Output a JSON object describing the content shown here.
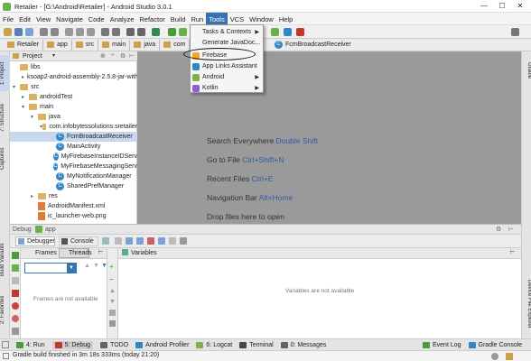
{
  "window": {
    "title": "Retailer - [G:\\Android\\Retailer] - Android Studio 3.0.1",
    "minimize": "—",
    "maximize": "☐",
    "close": "✕"
  },
  "menubar": [
    "File",
    "Edit",
    "View",
    "Navigate",
    "Code",
    "Analyze",
    "Refactor",
    "Build",
    "Run",
    "Tools",
    "VCS",
    "Window",
    "Help"
  ],
  "navbar": {
    "crumbs": [
      "Retailer",
      "app",
      "src",
      "main",
      "java",
      "com",
      "info"
    ],
    "right_crumb": "FcmBroadcastReceiver"
  },
  "project": {
    "view_label": "Project",
    "tree": [
      {
        "label": "libs",
        "kind": "folder",
        "arrow": "",
        "depth": 0
      },
      {
        "label": "ksoap2-android-assembly-2.5.8-jar-with",
        "kind": "folder",
        "arrow": "▸",
        "depth": 1
      },
      {
        "label": "src",
        "kind": "folder",
        "arrow": "▾",
        "depth": 0
      },
      {
        "label": "androidTest",
        "kind": "folder",
        "arrow": "▸",
        "depth": 1
      },
      {
        "label": "main",
        "kind": "folder",
        "arrow": "▾",
        "depth": 1
      },
      {
        "label": "java",
        "kind": "folder",
        "arrow": "▾",
        "depth": 2
      },
      {
        "label": "com.infobytessolutions.sretailer",
        "kind": "folder",
        "arrow": "▾",
        "depth": 3
      },
      {
        "label": "FcmBroadcastReceiver",
        "kind": "class",
        "arrow": "",
        "depth": 4,
        "selected": true
      },
      {
        "label": "MainActivity",
        "kind": "class",
        "arrow": "",
        "depth": 4
      },
      {
        "label": "MyFirebaseInstanceIDServ",
        "kind": "class",
        "arrow": "",
        "depth": 4
      },
      {
        "label": "MyFirebaseMessagingServ",
        "kind": "class",
        "arrow": "",
        "depth": 4
      },
      {
        "label": "MyNotificationManager",
        "kind": "class",
        "arrow": "",
        "depth": 4
      },
      {
        "label": "SharedPrefManager",
        "kind": "class",
        "arrow": "",
        "depth": 4
      },
      {
        "label": "res",
        "kind": "folder",
        "arrow": "▸",
        "depth": 2
      },
      {
        "label": "AndroidManifest.xml",
        "kind": "xml",
        "arrow": "",
        "depth": 2
      },
      {
        "label": "ic_launcher-web.png",
        "kind": "xml",
        "arrow": "",
        "depth": 2
      }
    ]
  },
  "editor_hints": [
    {
      "text": "Search Everywhere",
      "key": "Double Shift"
    },
    {
      "text": "Go to File",
      "key": "Ctrl+Shift+N"
    },
    {
      "text": "Recent Files",
      "key": "Ctrl+E"
    },
    {
      "text": "Navigation Bar",
      "key": "Alt+Home"
    },
    {
      "text": "Drop files here to open",
      "key": ""
    }
  ],
  "tools_menu": [
    {
      "label": "Tasks & Contexts",
      "submenu": true,
      "icon": ""
    },
    {
      "label": "Generate JavaDoc...",
      "submenu": false,
      "icon": ""
    },
    {
      "label": "Firebase",
      "submenu": false,
      "icon": "firebase-icon",
      "color": "#f5a623"
    },
    {
      "label": "App Links Assistant",
      "submenu": false,
      "icon": "app-links-icon",
      "color": "#2f86c8"
    },
    {
      "label": "Android",
      "submenu": true,
      "icon": "android-icon",
      "color": "#7cb342"
    },
    {
      "label": "Kotlin",
      "submenu": true,
      "icon": "kotlin-icon",
      "color": "#8e5fd4"
    }
  ],
  "debug": {
    "title": "Debug",
    "config": "app",
    "tabs": [
      "Debugger",
      "Console"
    ],
    "frames_label": "Frames",
    "threads_label": "Threads",
    "variables_label": "Variables",
    "frames_empty": "Frames are not available",
    "variables_empty": "Variables are not available"
  },
  "side_tabs": {
    "left": [
      "1: Project",
      "7: Structure",
      "Captures",
      "Build Variants",
      "2: Favorites"
    ],
    "right": [
      "Gradle",
      "Device File Explorer"
    ]
  },
  "bottom_tools": [
    {
      "label": "4: Run",
      "color": "#4a9e3a"
    },
    {
      "label": "5: Debug",
      "color": "#c0392b",
      "active": true
    },
    {
      "label": "TODO",
      "color": "#666"
    },
    {
      "label": "Android Profiler",
      "color": "#2f86c8"
    },
    {
      "label": "6: Logcat",
      "color": "#7cb342"
    },
    {
      "label": "Terminal",
      "color": "#444"
    },
    {
      "label": "0: Messages",
      "color": "#666"
    }
  ],
  "bottom_right_tools": [
    {
      "label": "Event Log",
      "color": "#4a9e3a"
    },
    {
      "label": "Gradle Console",
      "color": "#2f86c8"
    }
  ],
  "status": "Gradle build finished in 3m 18s 333ms (today 21:20)"
}
